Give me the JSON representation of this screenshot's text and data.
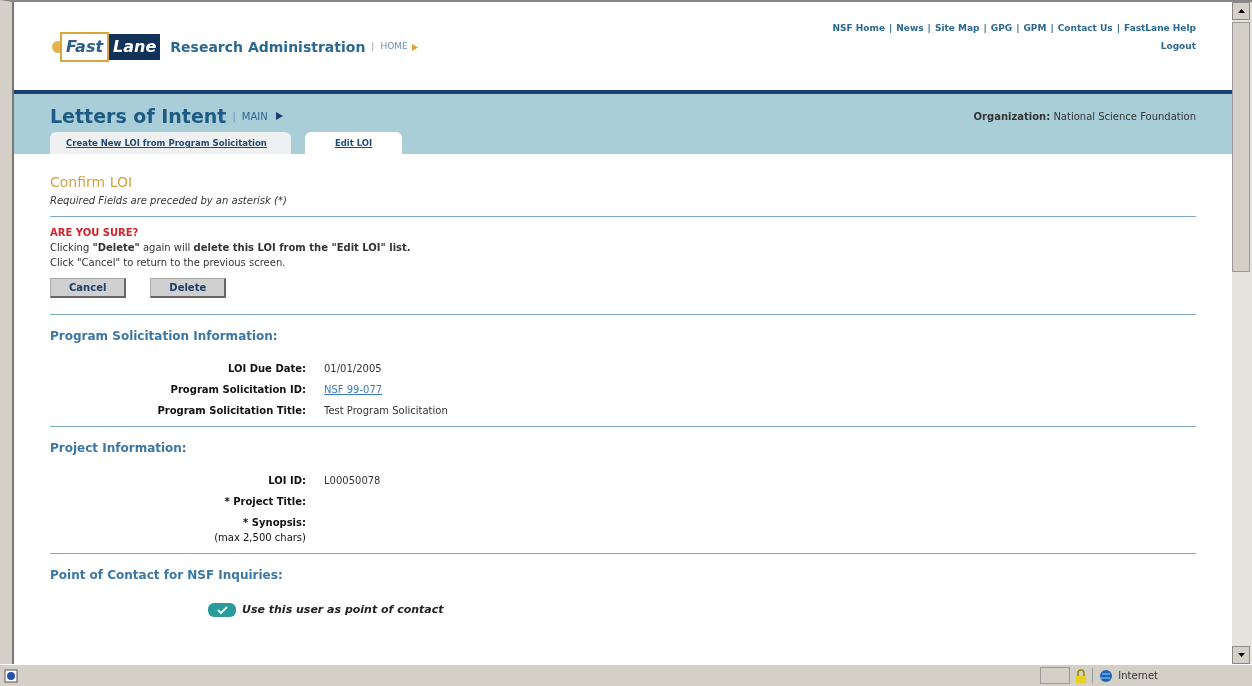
{
  "header": {
    "logo": {
      "part1": "Fast",
      "part2": "Lane"
    },
    "app_title": "Research Administration",
    "home_separator": "|",
    "home_link": "HOME",
    "link_separator": "|",
    "top_links": [
      "NSF Home",
      "News",
      "Site Map",
      "GPG",
      "GPM",
      "Contact Us",
      "FastLane Help"
    ],
    "logout": "Logout"
  },
  "band": {
    "title": "Letters of Intent",
    "main_separator": "|",
    "main_link": "MAIN",
    "organization_label": "Organization:",
    "organization_value": "National Science Foundation",
    "tabs": [
      {
        "label": "Create New LOI from Program Solicitation",
        "selected": false
      },
      {
        "label": "Edit LOI",
        "selected": true
      }
    ]
  },
  "page_title": "Confirm LOI",
  "required_note": "Required Fields are preceded by an asterisk (*)",
  "confirm": {
    "heading": "ARE YOU SURE?",
    "message": "Clicking **\"Delete\"** again will **delete this LOI from the \"Edit LOI\" list.**",
    "hint": "Click \"Cancel\" to return to the previous screen.",
    "buttons": [
      "Cancel",
      "Delete"
    ]
  },
  "sections": [
    {
      "title": "Program Solicitation Information:",
      "fields": [
        {
          "label": "LOI Due Date:",
          "value": "01/01/2005",
          "kind": "text"
        },
        {
          "label": "Program Solicitation ID:",
          "value": "NSF 99-077",
          "kind": "link"
        },
        {
          "label": "Program Solicitation Title:",
          "value": "Test Program Solicitation",
          "kind": "text"
        }
      ]
    },
    {
      "title": "Project Information:",
      "fields": [
        {
          "label": "LOI ID:",
          "value": "L00050078",
          "kind": "text"
        },
        {
          "label": "* Project Title:"
        },
        {
          "label": "* Synopsis:",
          "note": "(max 2,500 chars)"
        }
      ]
    }
  ],
  "contact": {
    "title": "Point of Contact for NSF Inquiries:",
    "checkbox": {
      "label": "Use this user as point of contact",
      "checked": true
    }
  },
  "status_bar": {
    "zone": "Internet"
  }
}
